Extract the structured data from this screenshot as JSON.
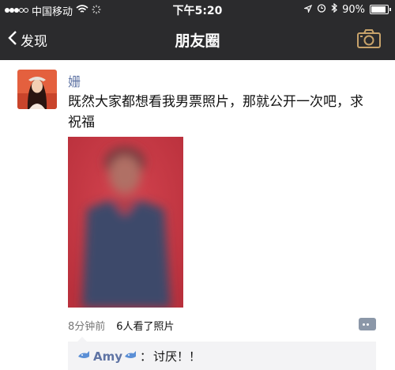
{
  "status_bar": {
    "carrier": "中国移动",
    "time": "下午5:20",
    "battery": "90%",
    "battery_level": 0.9
  },
  "nav": {
    "back_label": "发现",
    "title": "朋友圈"
  },
  "post": {
    "author": "姗",
    "text": "既然大家都想看我男票照片，那就公开一次吧，求祝福",
    "time_ago": "8分钟前",
    "views": "6人看了照片"
  },
  "comment": {
    "author": "Amy",
    "separator": "：",
    "text": "讨厌！！"
  },
  "colors": {
    "nav_bg": "#2b2b2d",
    "name_blue": "#5f74a4",
    "camera_gold": "#c7a26a"
  },
  "icons": [
    "signal-dots-icon",
    "wifi-icon",
    "loading-icon",
    "location-icon",
    "alarm-icon",
    "bluetooth-icon",
    "battery-icon",
    "back-chevron-icon",
    "camera-icon",
    "more-icon",
    "emoji-icon"
  ]
}
